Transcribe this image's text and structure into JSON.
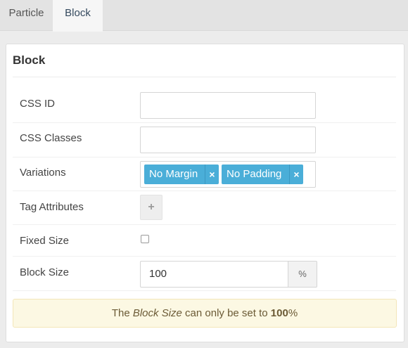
{
  "tabs": {
    "particle": "Particle",
    "block": "Block"
  },
  "panel": {
    "title": "Block"
  },
  "fields": {
    "css_id_label": "CSS ID",
    "css_id_value": "",
    "css_classes_label": "CSS Classes",
    "css_classes_value": "",
    "variations_label": "Variations",
    "variations": [
      {
        "text": "No Margin",
        "remove": "×"
      },
      {
        "text": "No Padding",
        "remove": "×"
      }
    ],
    "tag_attributes_label": "Tag Attributes",
    "tag_attributes_add": "+",
    "fixed_size_label": "Fixed Size",
    "block_size_label": "Block Size",
    "block_size_value": "100",
    "block_size_unit": "%"
  },
  "notice": {
    "prefix": "The ",
    "emphasis": "Block Size",
    "middle": " can only be set to ",
    "strong": "100",
    "suffix": "%"
  }
}
